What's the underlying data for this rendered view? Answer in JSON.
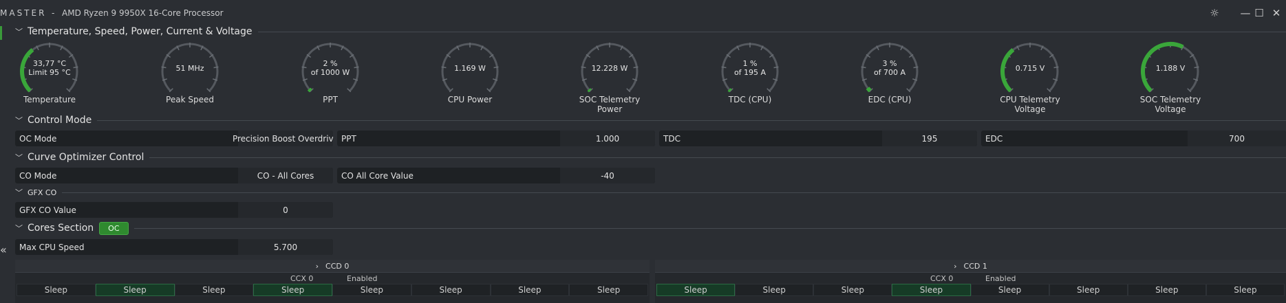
{
  "window": {
    "app_name": "MASTER",
    "separator": "-",
    "processor": "AMD Ryzen 9 9950X 16-Core Processor",
    "buttons": [
      "bug-icon",
      "minimize-icon",
      "maximize-icon",
      "close-icon"
    ]
  },
  "sections": {
    "temperature": "Temperature, Speed, Power, Current & Voltage",
    "control_mode": "Control Mode",
    "curve_optimizer": "Curve Optimizer Control",
    "gfx_co": "GFX CO",
    "cores": "Cores Section",
    "cores_badge": "OC"
  },
  "gauges": [
    {
      "line1": "33,77 °C",
      "line2": "Limit 95 °C",
      "label1": "Temperature",
      "label2": "",
      "fraction": 0.36
    },
    {
      "line1": "51  MHz",
      "line2": "",
      "label1": "Peak Speed",
      "label2": "",
      "fraction": 0.0
    },
    {
      "line1": "2 %",
      "line2": "of 1000 W",
      "label1": "PPT",
      "label2": "",
      "fraction": 0.02
    },
    {
      "line1": "1.169 W",
      "line2": "",
      "label1": "CPU Power",
      "label2": "",
      "fraction": 0.0
    },
    {
      "line1": "12.228 W",
      "line2": "",
      "label1": "SOC Telemetry",
      "label2": "Power",
      "fraction": 0.01
    },
    {
      "line1": "1 %",
      "line2": "of 195 A",
      "label1": "TDC (CPU)",
      "label2": "",
      "fraction": 0.01
    },
    {
      "line1": "3 %",
      "line2": "of 700 A",
      "label1": "EDC (CPU)",
      "label2": "",
      "fraction": 0.03
    },
    {
      "line1": "0.715 V",
      "line2": "",
      "label1": "CPU Telemetry",
      "label2": "Voltage",
      "fraction": 0.36
    },
    {
      "line1": "1.188 V",
      "line2": "",
      "label1": "SOC Telemetry",
      "label2": "Voltage",
      "fraction": 0.6
    }
  ],
  "control_mode": {
    "oc_mode": {
      "label": "OC Mode",
      "value": "Precision Boost Overdrive"
    },
    "ppt": {
      "label": "PPT",
      "value": "1.000"
    },
    "tdc": {
      "label": "TDC",
      "value": "195"
    },
    "edc": {
      "label": "EDC",
      "value": "700"
    }
  },
  "curve_optimizer": {
    "co_mode": {
      "label": "CO Mode",
      "value": "CO - All Cores"
    },
    "co_all": {
      "label": "CO All Core Value",
      "value": "-40"
    }
  },
  "gfx_co": {
    "label": "GFX CO Value",
    "value": "0"
  },
  "cores": {
    "max_speed": {
      "label": "Max CPU Speed",
      "value": "5.700"
    }
  },
  "ccds": [
    {
      "name": "CCD 0",
      "ccx": "CCX 0",
      "status": "Enabled",
      "cores": [
        "Sleep",
        "Sleep",
        "Sleep",
        "Sleep",
        "Sleep",
        "Sleep",
        "Sleep",
        "Sleep"
      ],
      "active": [
        false,
        true,
        false,
        true,
        false,
        false,
        false,
        false
      ]
    },
    {
      "name": "CCD 1",
      "ccx": "CCX 0",
      "status": "Enabled",
      "cores": [
        "Sleep",
        "Sleep",
        "Sleep",
        "Sleep",
        "Sleep",
        "Sleep",
        "Sleep",
        "Sleep"
      ],
      "active": [
        true,
        false,
        false,
        true,
        false,
        false,
        false,
        false
      ]
    }
  ],
  "colors": {
    "accent": "#3aa63a",
    "gauge_track": "#55595f",
    "bg": "#2b2e33",
    "row": "#1e2124"
  }
}
